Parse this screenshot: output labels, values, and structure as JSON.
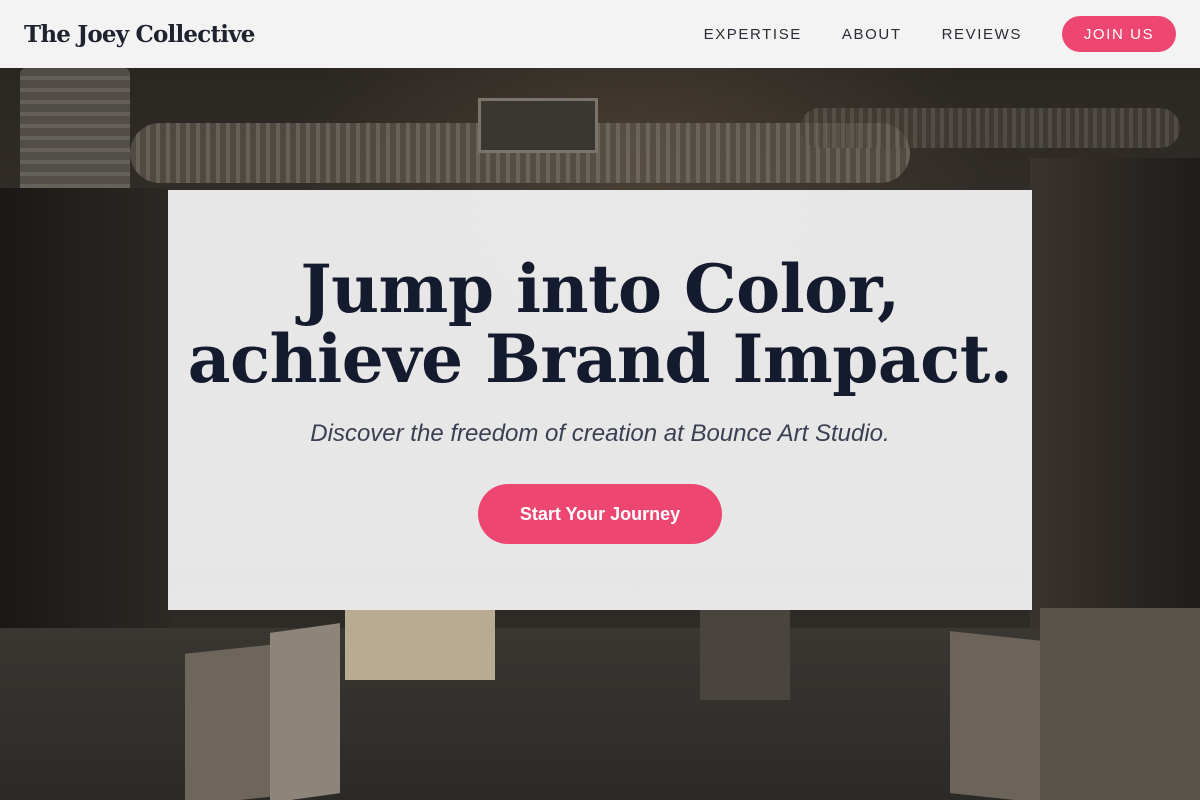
{
  "header": {
    "brand": "The Joey Collective",
    "nav": {
      "expertise": "EXPERTISE",
      "about": "ABOUT",
      "reviews": "REVIEWS"
    },
    "cta": "JOIN US"
  },
  "hero": {
    "headline_line1": "Jump into Color,",
    "headline_line2": "achieve Brand Impact.",
    "subheadline": "Discover the freedom of creation at Bounce Art Studio.",
    "cta": "Start Your Journey"
  },
  "colors": {
    "accent": "#ec4671",
    "header_bg": "#f3f3f3",
    "headline_text": "#141b2e"
  }
}
